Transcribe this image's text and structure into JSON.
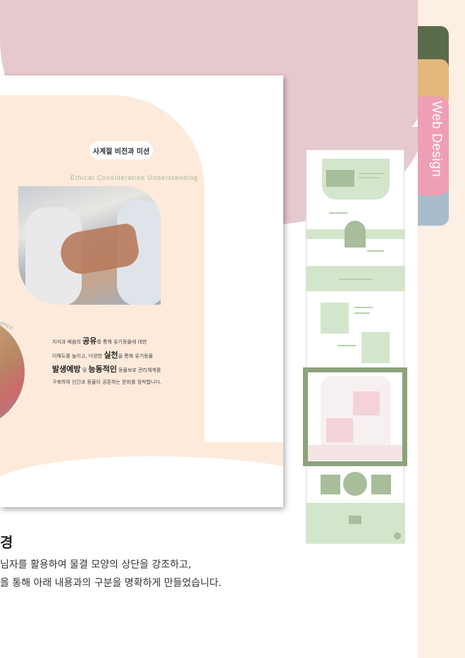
{
  "side_tab": {
    "label": "Web Design"
  },
  "card": {
    "pill": "사계절 비전과 미션",
    "curve_text": "Ethical Consideration Understanding",
    "fence_text": "ence",
    "paragraph": {
      "line1_a": "지식과 배움의 ",
      "line1_b": "공유",
      "line1_c": "를 통해 유기동물에 대한",
      "line2_a": "이해도를 높이고, 다양한 ",
      "line2_b": "실천",
      "line2_c": "을 통해 유기동물",
      "line3_a": "발생예방",
      "line3_b": " 및 ",
      "line3_c": "능동적인",
      "line3_d": " 동물보호 관리체계를",
      "line4": "구축하여 인간과 동물이 공존하는 문화를 정착합니다."
    }
  },
  "bottom": {
    "heading": "경",
    "line1": "님자를 활용하여 물결 모양의 상단을 강조하고,",
    "line2": "을 통해 아래 내용과의 구분을 명확하게 만들었습니다."
  },
  "colors": {
    "blob": "#e6c9cc",
    "peach": "#fdeadb",
    "accent_green": "#8ca37b",
    "tab_pink": "#ef9fb4"
  }
}
